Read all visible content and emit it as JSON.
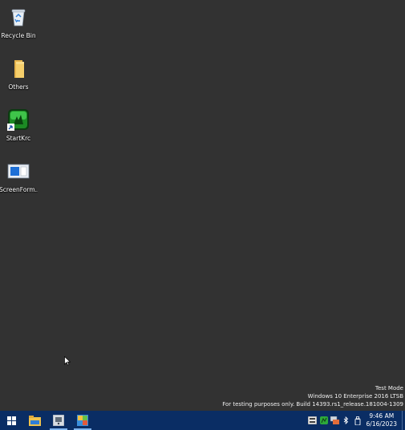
{
  "desktop": {
    "icons": [
      {
        "label": "Recycle Bin",
        "icon": "recycle-bin-icon"
      },
      {
        "label": "Others",
        "icon": "folder-icon"
      },
      {
        "label": "StartKrc",
        "icon": "startkrc-app-icon"
      },
      {
        "label": "ScreenForm....",
        "icon": "screenform-app-icon"
      }
    ]
  },
  "watermark": {
    "line1": "Test Mode",
    "line2": "Windows 10 Enterprise 2016 LTSB",
    "line3": "For testing purposes only. Build 14393.rs1_release.181004-1309"
  },
  "taskbar": {
    "start": "windows-start-icon",
    "pinned": [
      "file-explorer-icon",
      "disk-utility-icon",
      "control-panel-icon"
    ],
    "tray": [
      "keyboard-ime-icon",
      "green-app-tray-icon",
      "network-tray-icon",
      "bluetooth-icon",
      "usb-device-icon"
    ],
    "clock_time": "9:46 AM",
    "clock_date": "6/16/2023"
  },
  "colors": {
    "desktop_bg": "#323232",
    "taskbar_bg": "#0a2d64"
  }
}
